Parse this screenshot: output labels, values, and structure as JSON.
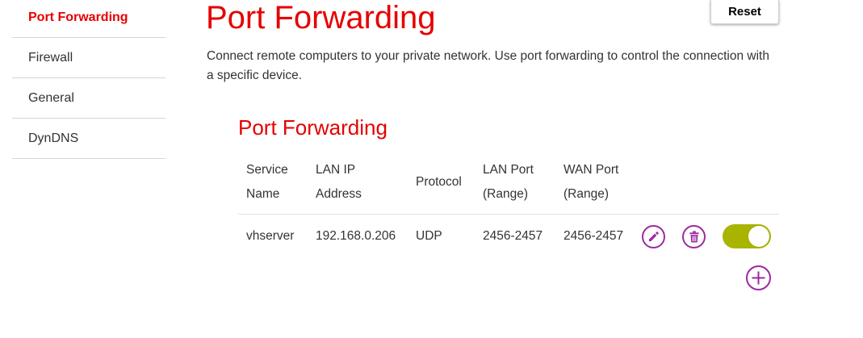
{
  "sidebar": {
    "items": [
      {
        "label": "Port Forwarding",
        "active": true
      },
      {
        "label": "Firewall"
      },
      {
        "label": "General"
      },
      {
        "label": "DynDNS"
      }
    ]
  },
  "header": {
    "title": "Port Forwarding",
    "reset_label": "Reset",
    "description": "Connect remote computers to your private network. Use port forwarding to control the connection with a specific device."
  },
  "section": {
    "title": "Port Forwarding"
  },
  "table": {
    "headers": {
      "service_name": [
        "Service",
        "Name"
      ],
      "lan_ip": [
        "LAN IP",
        "Address"
      ],
      "protocol": "Protocol",
      "lan_port": [
        "LAN Port",
        "(Range)"
      ],
      "wan_port": [
        "WAN Port",
        "(Range)"
      ]
    },
    "rows": [
      {
        "service_name": "vhserver",
        "lan_ip": "192.168.0.206",
        "protocol": "UDP",
        "lan_port": "2456-2457",
        "wan_port": "2456-2457",
        "enabled": true
      }
    ]
  },
  "icons": {
    "edit": "pencil-icon",
    "delete": "trash-icon",
    "add": "plus-icon"
  },
  "colors": {
    "brand_red": "#e60000",
    "action_purple": "#9c2aa0",
    "toggle_on": "#a8b400"
  }
}
